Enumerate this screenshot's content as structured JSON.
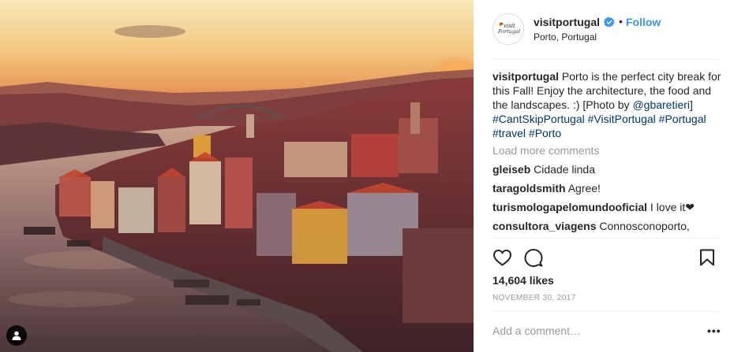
{
  "post": {
    "username": "visitportugal",
    "follow_label": "Follow",
    "location": "Porto, Portugal",
    "avatar_text_1": "visit",
    "avatar_text_2": "Portugal",
    "caption": {
      "text": "Porto is the perfect city break for this Fall! Enjoy the architecture, the food and the landscapes. :) [Photo by ",
      "mention": "@gbaretieri",
      "close": "]",
      "hashtags": [
        "#CantSkipPortugal",
        "#VisitPortugal",
        "#Portugal",
        "#travel",
        "#Porto"
      ]
    },
    "load_more": "Load more comments",
    "comments": [
      {
        "user": "gleiseb",
        "text": "Cidade linda"
      },
      {
        "user": "taragoldsmith",
        "text": "Agree!"
      },
      {
        "user": "turismologapelomundooficial",
        "text": "I love it❤"
      },
      {
        "user": "consultora_viagens",
        "text": "Connosconoporto,"
      }
    ],
    "likes": "14,604 likes",
    "date": "NOVEMBER 30, 2017",
    "add_comment_placeholder": "Add a comment…",
    "more_label": "•••"
  },
  "icons": {
    "like": "heart-icon",
    "comment": "speech-bubble-icon",
    "save": "bookmark-icon",
    "verified": "verified-badge-icon",
    "user_tag": "person-icon"
  },
  "colors": {
    "accent": "#3897f0",
    "hashtag": "#003569",
    "muted": "#999999"
  }
}
